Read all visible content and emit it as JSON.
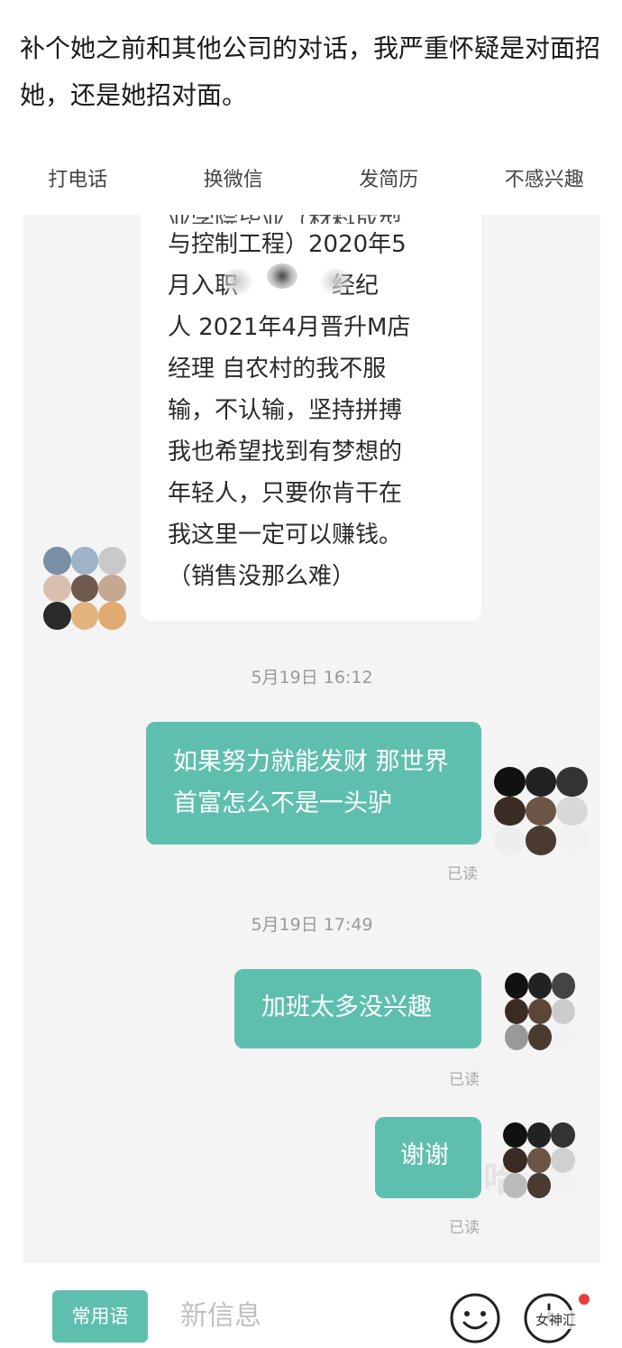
{
  "post": {
    "caption": "补个她之前和其他公司的对话，我严重怀疑是对面招她，还是她招对面。"
  },
  "chat_actions": [
    "打电话",
    "换微信",
    "发简历",
    "不感兴趣"
  ],
  "messages": {
    "incoming": {
      "top_partial": "业学院毕业（材料成型",
      "text": "与控制工程）2020年5\n月入职　　　　经纪\n人 2021年4月晋升M店\n经理 自农村的我不服\n输，不认输，坚持拼搏\n我也希望找到有梦想的\n年轻人，只要你肯干在\n我这里一定可以赚钱。\n（销售没那么难）"
    },
    "time_1": "5月19日 16:12",
    "out_1": "如果努力就能发财 那世界首富怎么不是一头驴",
    "out_1_read": "已读",
    "time_2": "5月19日 17:49",
    "out_2": "加班太多没兴趣",
    "out_2_read": "已读",
    "out_3": "谢谢",
    "out_3_read": "已读"
  },
  "input_bar": {
    "quick_phrases": "常用语",
    "placeholder": "新信息",
    "emoji_icon": "smiley-icon",
    "more_icon": "clock-icon"
  },
  "watermark": {
    "brand": "女神汇"
  },
  "colors": {
    "accent": "#5fbfaf",
    "chat_bg": "#f4f4f4",
    "badge": "#ee3b3b"
  }
}
